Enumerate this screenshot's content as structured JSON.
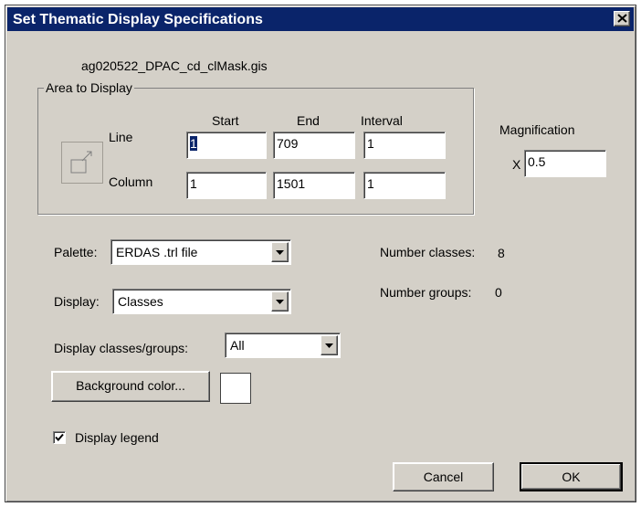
{
  "window": {
    "title": "Set Thematic Display Specifications",
    "close_icon": "close-icon"
  },
  "filename": "ag020522_DPAC_cd_clMask.gis",
  "area": {
    "label": "Area to Display",
    "col_start": "Start",
    "col_end": "End",
    "col_interval": "Interval",
    "line_label": "Line",
    "column_label": "Column",
    "line": {
      "start": "1",
      "end": "709",
      "interval": "1"
    },
    "column": {
      "start": "1",
      "end": "1501",
      "interval": "1"
    },
    "icon": "zoom-region-icon"
  },
  "magnification": {
    "label": "Magnification",
    "prefix": "X",
    "value": "0.5"
  },
  "palette": {
    "label": "Palette:",
    "value": "ERDAS .trl file"
  },
  "display": {
    "label": "Display:",
    "value": "Classes"
  },
  "display_classes": {
    "label": "Display classes/groups:",
    "value": "All"
  },
  "stats": {
    "classes_label": "Number classes:",
    "classes_value": "8",
    "groups_label": "Number groups:",
    "groups_value": "0"
  },
  "background": {
    "button_label": "Background color...",
    "color": "#ffffff"
  },
  "legend": {
    "label": "Display legend",
    "checked": true
  },
  "buttons": {
    "cancel": "Cancel",
    "ok": "OK"
  }
}
